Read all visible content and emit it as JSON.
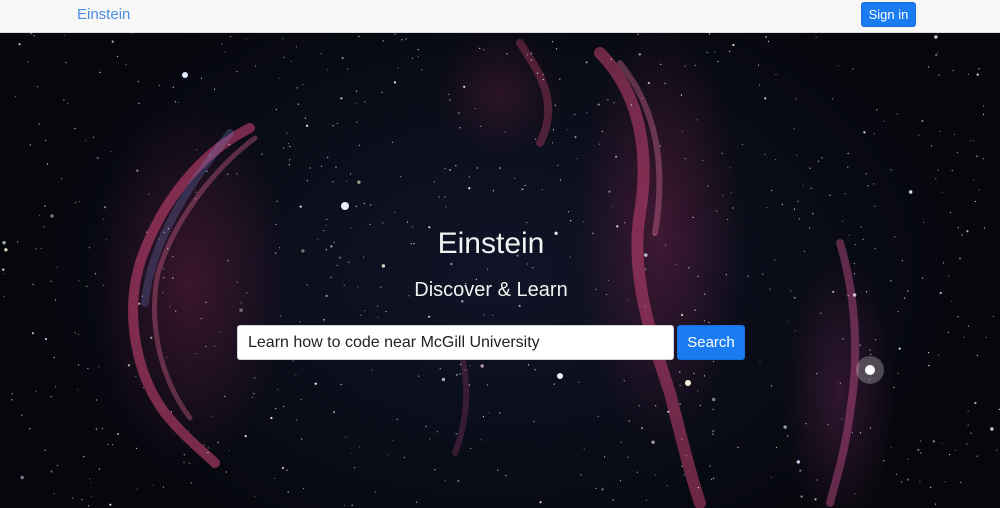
{
  "navbar": {
    "brand": "Einstein",
    "signin_label": "Sign in"
  },
  "hero": {
    "title": "Einstein",
    "subtitle": "Discover & Learn",
    "background": "starfield-nebula-image"
  },
  "search": {
    "value": "Learn how to code near McGill University",
    "button_label": "Search"
  },
  "colors": {
    "accent": "#1b7cf2",
    "brand_link": "#4a8fe0",
    "navbar_bg": "#f7f7f7"
  }
}
